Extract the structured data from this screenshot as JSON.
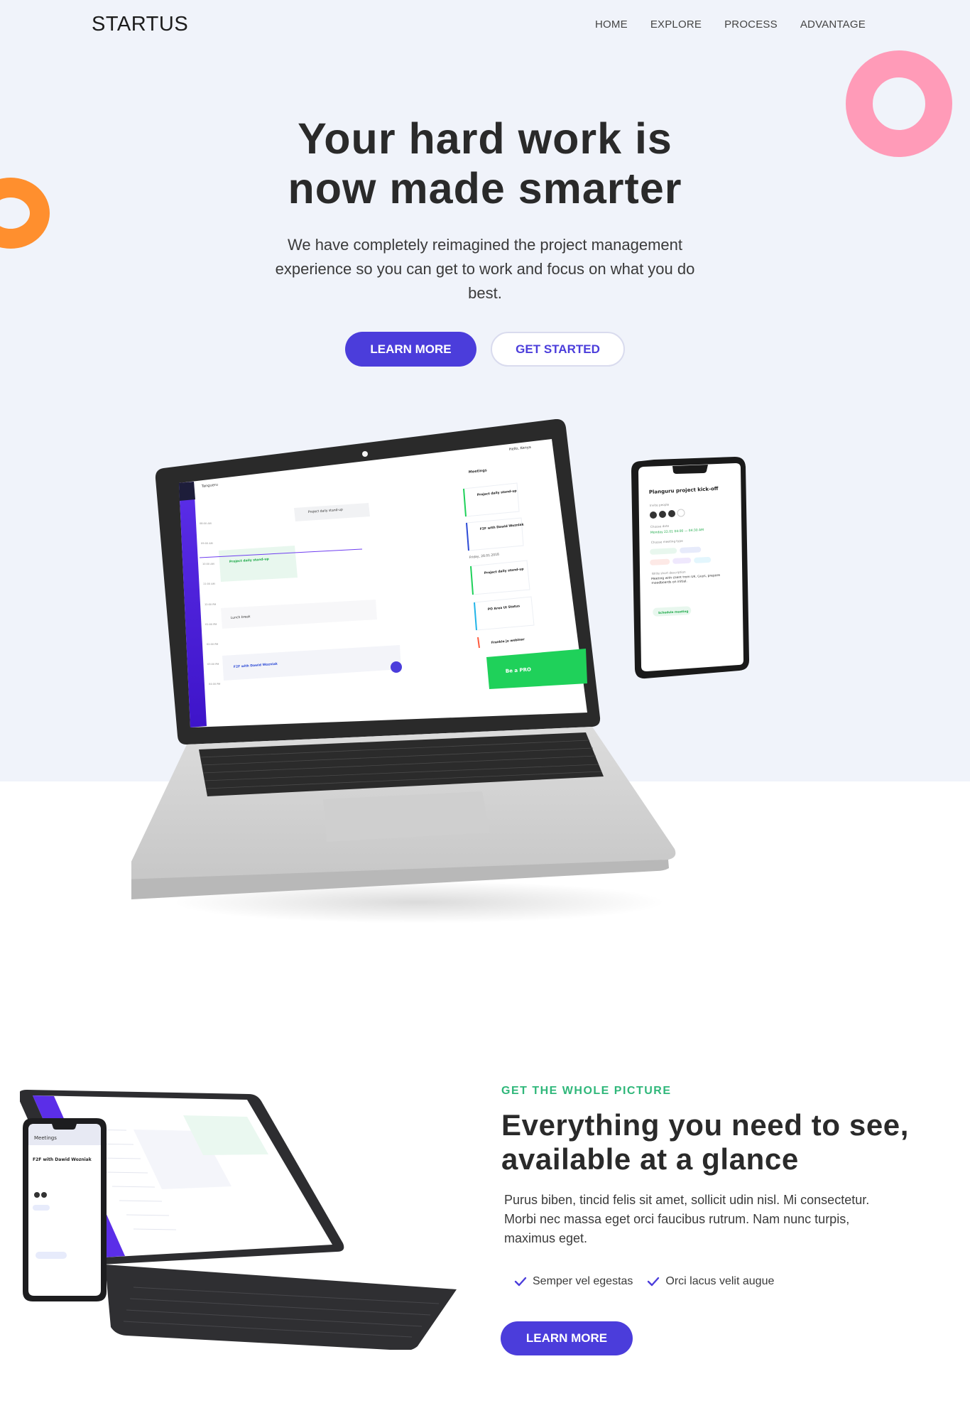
{
  "brand": {
    "name": "STARTUS"
  },
  "nav": {
    "items": [
      {
        "label": "HOME"
      },
      {
        "label": "EXPLORE"
      },
      {
        "label": "PROCESS"
      },
      {
        "label": "ADVANTAGE"
      }
    ]
  },
  "hero": {
    "title_line1": "Your hard work is",
    "title_line2": "now made smarter",
    "subtitle": "We have completely reimagined the project management experience so you can get to work and focus on what you do best.",
    "primary_label": "LEARN MORE",
    "secondary_label": "GET STARTED"
  },
  "laptop_screen": {
    "brand": "Tangueru",
    "greeting": "Hello, Kenya",
    "meetings_title": "Meetings",
    "date_label": "Friday, 28.01.2018",
    "cards": [
      "Project daily stand-up",
      "F2F with Dawid Wozniak",
      "Project daily stand-up",
      "PO Area UI Status",
      "Frankie jo webinar"
    ],
    "events": [
      "Project daily stand-up",
      "Project daily stand-up",
      "Lunch break",
      "F2F with Dawid Wozniak"
    ],
    "times": [
      "08:00 AM",
      "09:00 AM",
      "10:00 AM",
      "11:00 AM",
      "12:00 PM",
      "01:00 PM",
      "02:00 PM",
      "03:00 PM",
      "04:00 PM"
    ],
    "promo": "Be a PRO"
  },
  "phone_screen": {
    "title": "Planguru project kick-off",
    "invite_label": "Invite people",
    "date_label": "Choose date",
    "date_value": "Monday 22.01 04:00 — 04:30 AM",
    "type_label": "Choose meeting type",
    "desc_label": "Write short description",
    "desc_value": "Meeting with client from UK. Guys, prepare moodboards on initial.",
    "cta": "Schedule meeting"
  },
  "tablet_screen": {
    "phone_title": "Meetings",
    "phone_card": "F2F with Dawid Wozniak"
  },
  "feature": {
    "eyebrow": "GET THE WHOLE PICTURE",
    "title": "Everything you need to see, available at a glance",
    "body": "Purus biben, tincid felis sit amet, sollicit udin nisl. Mi consectetur. Morbi nec massa eget orci faucibus rutrum. Nam nunc turpis, maximus eget.",
    "checks": [
      {
        "label": "Semper vel egestas"
      },
      {
        "label": "Orci lacus velit augue"
      }
    ],
    "cta_label": "LEARN MORE"
  },
  "colors": {
    "accent": "#4b3ddb",
    "hero_bg": "#f0f3fa",
    "green": "#2fb77a",
    "pink": "#ff9bb8",
    "orange": "#ff8f2e"
  }
}
